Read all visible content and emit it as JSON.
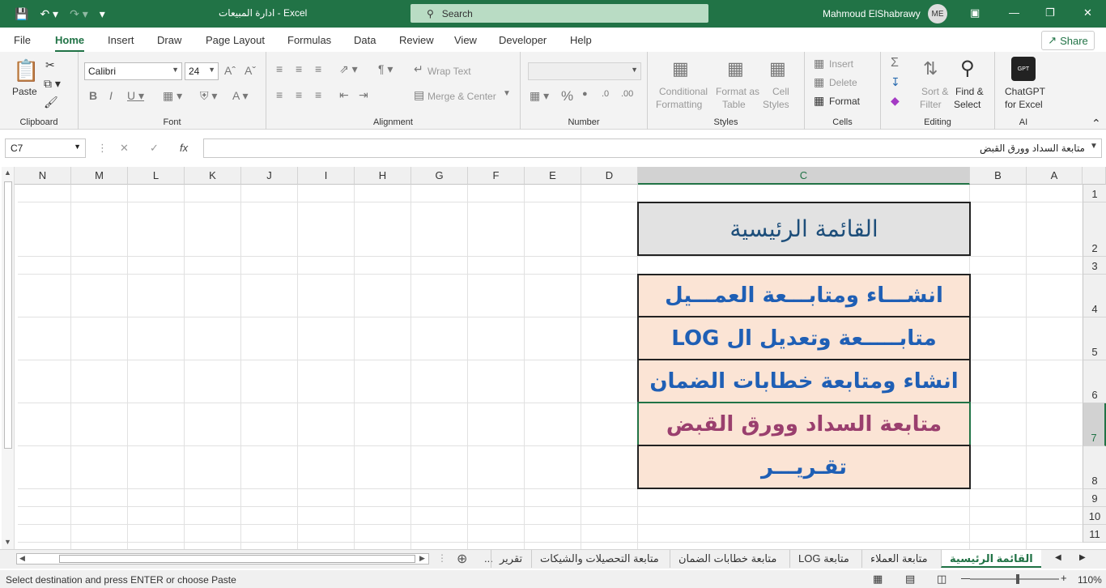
{
  "titlebar": {
    "title": "ادارة المبيعات  -  Excel",
    "search_placeholder": "Search",
    "user_name": "Mahmoud ElShabrawy",
    "avatar_initials": "ME"
  },
  "menu": {
    "tabs": [
      "File",
      "Home",
      "Insert",
      "Draw",
      "Page Layout",
      "Formulas",
      "Data",
      "Review",
      "View",
      "Developer",
      "Help"
    ],
    "active_tab": "Home",
    "share_label": "Share"
  },
  "ribbon": {
    "clipboard": {
      "paste": "Paste",
      "label": "Clipboard"
    },
    "font": {
      "name": "Calibri",
      "size": "24",
      "label": "Font"
    },
    "alignment": {
      "wrap": "Wrap Text",
      "merge": "Merge & Center",
      "label": "Alignment"
    },
    "number": {
      "label": "Number"
    },
    "styles": {
      "cond1": "Conditional",
      "cond2": "Formatting",
      "fmt1": "Format as",
      "fmt2": "Table",
      "cell1": "Cell",
      "cell2": "Styles",
      "label": "Styles"
    },
    "cells": {
      "insert": "Insert",
      "delete": "Delete",
      "format": "Format",
      "label": "Cells"
    },
    "editing": {
      "sort1": "Sort &",
      "sort2": "Filter",
      "find1": "Find &",
      "find2": "Select",
      "label": "Editing"
    },
    "ai": {
      "gpt1": "ChatGPT",
      "gpt2": "for Excel",
      "logo": "GPT",
      "label": "AI"
    }
  },
  "formula_bar": {
    "name_box": "C7",
    "formula": "متابعة السداد وورق القبض"
  },
  "grid": {
    "columns": [
      "N",
      "M",
      "L",
      "K",
      "J",
      "I",
      "H",
      "G",
      "F",
      "E",
      "D",
      "C",
      "B",
      "A"
    ],
    "selected_column": "C",
    "rows": [
      "1",
      "2",
      "3",
      "4",
      "5",
      "6",
      "7",
      "8",
      "9",
      "10",
      "11"
    ],
    "selected_row": "7",
    "cells": {
      "c2": "القائمة الرئيسية",
      "c4": "انشـــاء ومتابـــعة العمـــيل",
      "c5": "متابـــــعة وتعديل ال LOG",
      "c6": "انشاء ومتابعة خطابات الضمان",
      "c7": "متابعة السداد وورق القبض",
      "c8": "تقـريـــر"
    }
  },
  "sheet_tabs": {
    "tabs": [
      "القائمة الرئيسية",
      "متابعة العملاء",
      "متابعة LOG",
      "متابعة خطابات الضمان",
      "متابعة التحصيلات والشيكات",
      "تقرير"
    ],
    "active": "القائمة الرئيسية",
    "more": "..."
  },
  "status": {
    "message": "Select destination and press ENTER or choose Paste",
    "zoom": "110%"
  },
  "colors": {
    "excel_green": "#217346",
    "menu_fill": "#fbe4d5",
    "title_fill": "#e2e2e2",
    "menu_text": "#1f5fb5",
    "active_text": "#9a3f6e"
  }
}
